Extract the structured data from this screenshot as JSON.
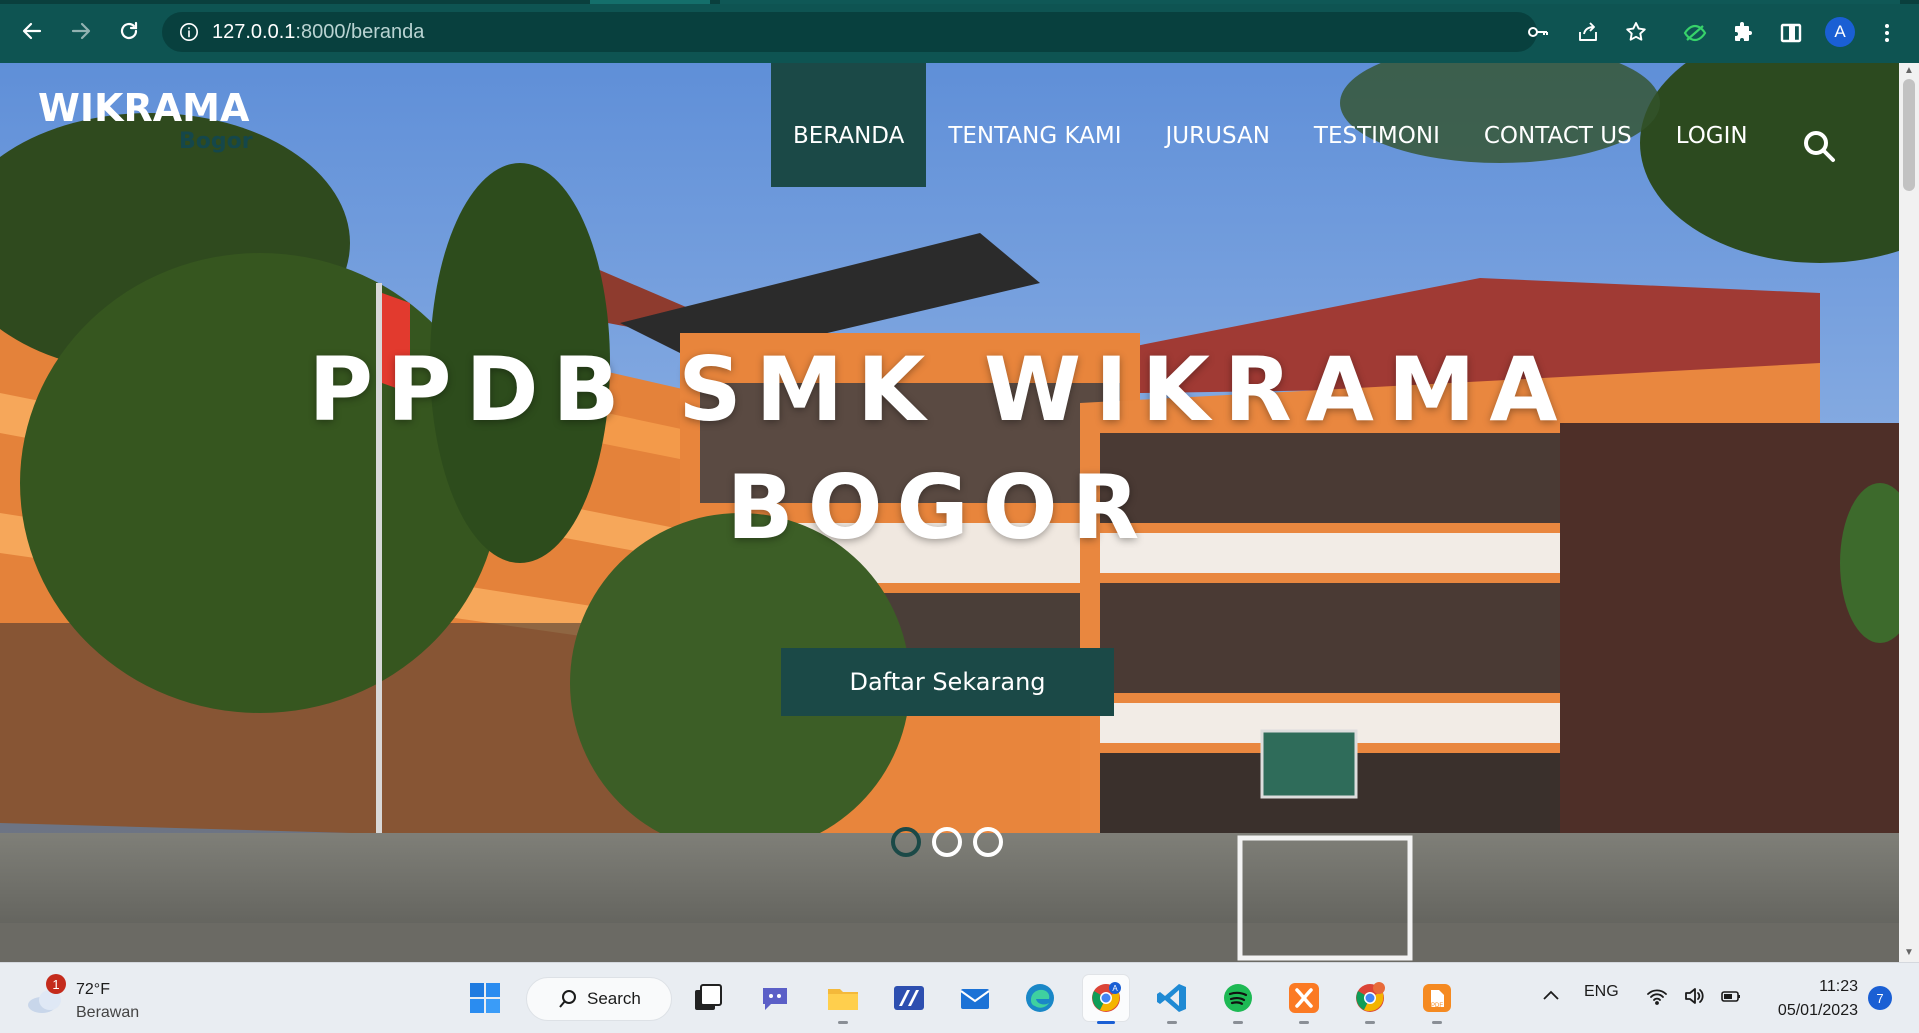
{
  "browser": {
    "url_host": "127.0.0.1",
    "url_path": ":8000/beranda",
    "profile_initial": "A",
    "nav_icons": [
      "back-icon",
      "forward-icon",
      "reload-icon"
    ],
    "right_icons": [
      "key-icon",
      "share-icon",
      "star-icon",
      "extension-eye-icon",
      "puzzle-icon",
      "sidepanel-icon",
      "profile-avatar",
      "menu-dots-icon"
    ]
  },
  "site": {
    "logo_main": "WIKRAMA",
    "logo_sub": "Bogor",
    "nav": [
      {
        "label": "BERANDA",
        "active": true
      },
      {
        "label": "TENTANG KAMI",
        "active": false
      },
      {
        "label": "JURUSAN",
        "active": false
      },
      {
        "label": "TESTIMONI",
        "active": false
      },
      {
        "label": "CONTACT US",
        "active": false
      },
      {
        "label": "LOGIN",
        "active": false
      }
    ],
    "hero_title_line1": "PPDB SMK WIKRAMA",
    "hero_title_line2": "BOGOR",
    "cta_label": "Daftar Sekarang",
    "carousel": {
      "slides": 3,
      "active_index": 0
    },
    "colors": {
      "primary": "#1b4947",
      "browser_frame": "#0e5452"
    }
  },
  "taskbar": {
    "weather_temp": "72°F",
    "weather_desc": "Berawan",
    "weather_badge": "1",
    "search_label": "Search",
    "apps": [
      "windows-start-icon",
      "search",
      "task-view-icon",
      "chat-icon",
      "file-explorer-icon",
      "pen-app-icon",
      "mail-icon",
      "edge-icon",
      "chrome-icon",
      "vscode-icon",
      "spotify-icon",
      "xampp-icon",
      "chrome-profile-icon",
      "pdf-app-icon"
    ],
    "tray_lang": "ENG",
    "time": "11:23",
    "date": "05/01/2023",
    "notif_count": "7"
  }
}
